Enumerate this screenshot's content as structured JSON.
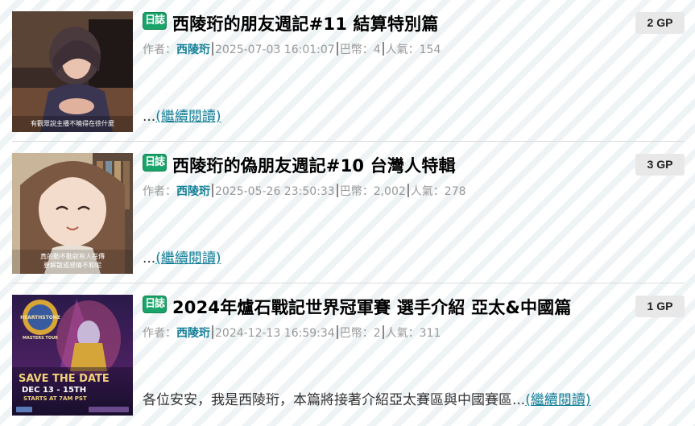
{
  "posts": [
    {
      "tag": "日誌",
      "title": "西陵珩的朋友週記#11 結算特別篇",
      "gp": "2 GP",
      "author_label": "作者：",
      "author": "西陵珩",
      "date": "2025-07-03 16:01:07",
      "coins_label": "巴幣：",
      "coins": "4",
      "views_label": "人氣：",
      "views": "154",
      "summary": "...",
      "read_more": "(繼續閱讀)",
      "thumb_caption": "有觀眾說主播不曉得在徐什麼"
    },
    {
      "tag": "日誌",
      "title": "西陵珩的偽朋友週記#10 台灣人特輯",
      "gp": "3 GP",
      "author_label": "作者：",
      "author": "西陵珩",
      "date": "2025-05-26 23:50:33",
      "coins_label": "巴幣：",
      "coins": "2,002",
      "views_label": "人氣：",
      "views": "278",
      "summary": "...",
      "read_more": "(繼續閱讀)",
      "thumb_caption": "真的動不動就有人在傳",
      "thumb_caption2": "要解散或感情不和呢"
    },
    {
      "tag": "日誌",
      "title": "2024年爐石戰記世界冠軍賽 選手介紹 亞太&中國篇",
      "gp": "1 GP",
      "author_label": "作者：",
      "author": "西陵珩",
      "date": "2024-12-13 16:59:34",
      "coins_label": "巴幣：",
      "coins": "2",
      "views_label": "人氣：",
      "views": "311",
      "summary": "各位安安，我是西陵珩，本篇將接著介紹亞太賽區與中國賽區...",
      "read_more": "(繼續閱讀)",
      "poster_logo": "HEARTHSTONE",
      "poster_sub": "MASTERS TOUR",
      "poster_headline": "SAVE THE DATE",
      "poster_dates": "DEC 13 - 15TH",
      "poster_time": "STARTS AT 7AM PST"
    }
  ],
  "colors": {
    "accent": "#117e96",
    "tag_bg": "#1aa46b",
    "gp_bg": "#e8e8e8"
  }
}
